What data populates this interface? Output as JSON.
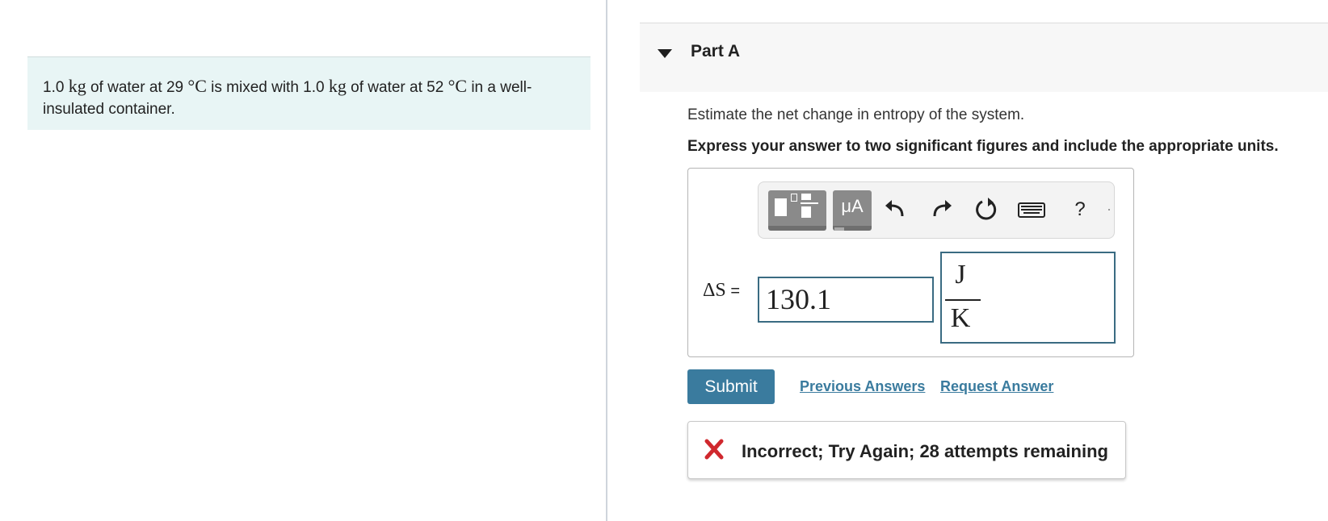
{
  "problem": {
    "m1": "1.0",
    "unit_kg": "kg",
    "text1": " of water at 29 ",
    "unit_deg": "°C",
    "text2": " is mixed with 1.0 ",
    "text3": " of water at 52 ",
    "text4": " in a well-insulated container."
  },
  "part": {
    "title": "Part A",
    "prompt": "Estimate the net change in entropy of the system.",
    "instruction": "Express your answer to two significant figures and include the appropriate units."
  },
  "toolbar": {
    "mu_label": "μA",
    "help_label": "?",
    "icons": [
      "templates-icon",
      "mu-a-icon",
      "undo-icon",
      "redo-icon",
      "reset-icon",
      "keyboard-icon",
      "help-icon"
    ]
  },
  "answer": {
    "label_var": "ΔS",
    "label_eq": " =",
    "value": "130.1",
    "unit_numerator": "J",
    "unit_denominator": "K"
  },
  "actions": {
    "submit": "Submit",
    "previous_answers": "Previous Answers",
    "request_answer": "Request Answer"
  },
  "feedback": {
    "message": "Incorrect; Try Again; 28 attempts remaining",
    "status_color": "#d0282e"
  },
  "colors": {
    "accent": "#3a7b9e",
    "problem_bg": "#e8f5f5",
    "input_border": "#3a6b82"
  }
}
